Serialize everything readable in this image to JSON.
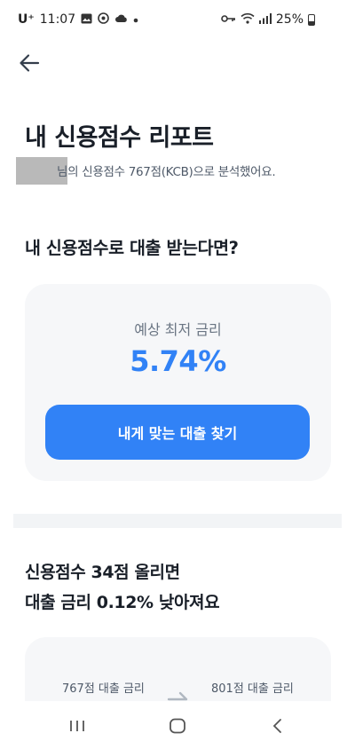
{
  "status_bar": {
    "carrier": "U⁺",
    "time": "11:07",
    "battery": "25%",
    "icons": [
      "gallery-icon",
      "app-icon",
      "cloud-icon",
      "dot-icon",
      "key-icon",
      "wifi-icon",
      "signal-icon",
      "battery-icon"
    ]
  },
  "header": {
    "back_icon": "arrow-left-icon"
  },
  "page": {
    "title": "내 신용점수 리포트",
    "subtitle": "님의 신용점수 767점(KCB)으로 분석했어요."
  },
  "loan_section": {
    "heading": "내 신용점수로 대출 받는다면?",
    "card": {
      "label": "예상 최저 금리",
      "rate": "5.74%",
      "cta_label": "내게 맞는 대출 찾기"
    }
  },
  "improve_section": {
    "line1": "신용점수 34점 올리면",
    "line2": "대출 금리 0.12% 낮아져요",
    "compare": {
      "left_label": "767점 대출 금리",
      "right_label": "801점 대출 금리"
    }
  },
  "nav": {
    "icons": [
      "recent-apps-icon",
      "home-icon",
      "back-nav-icon"
    ]
  },
  "colors": {
    "accent": "#3182f6",
    "card_bg": "#f6f7f9",
    "text": "#191f28",
    "muted": "#6b7684"
  }
}
